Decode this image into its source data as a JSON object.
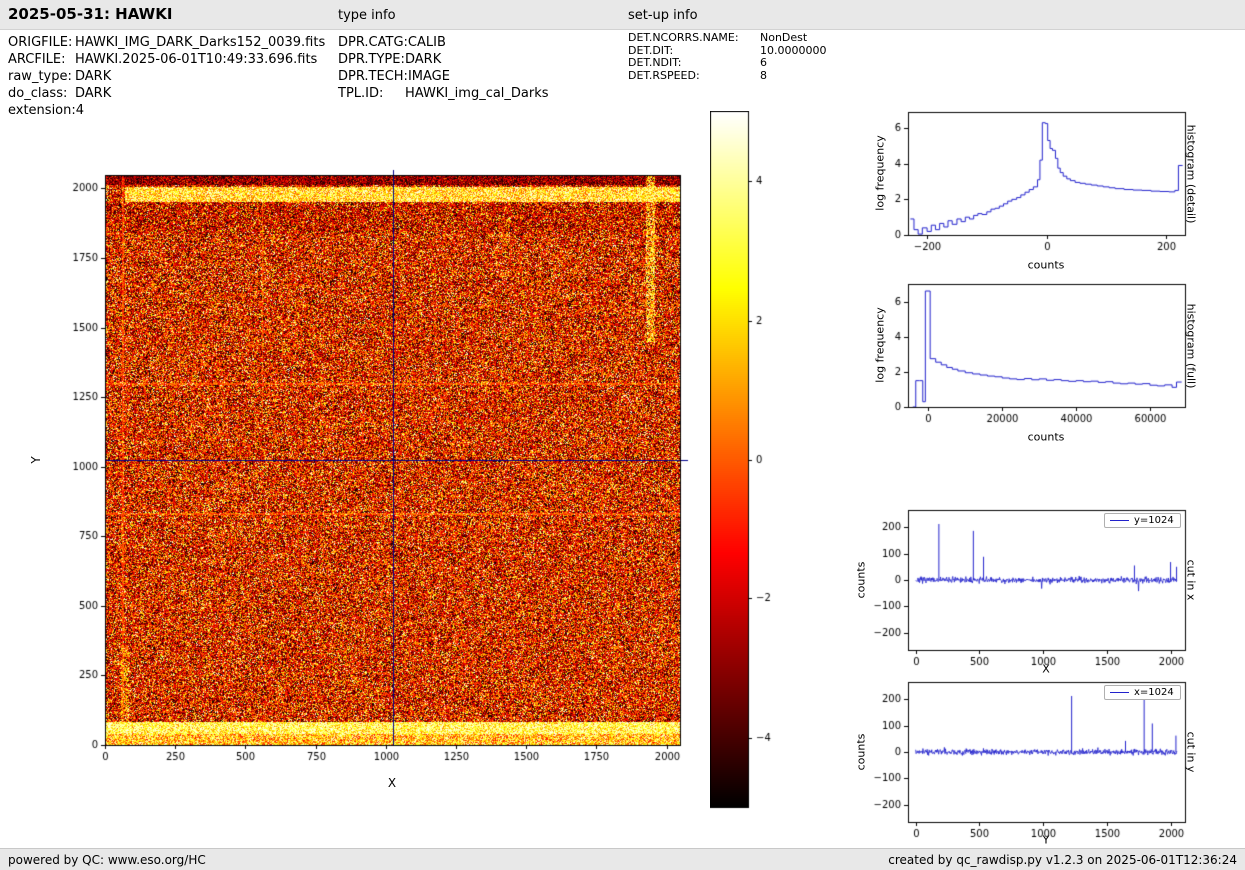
{
  "header": {
    "title": "2025-05-31: HAWKI",
    "type_info_label": "type info",
    "setup_info_label": "set-up info"
  },
  "file_info": {
    "rows": [
      {
        "label": "ORIGFILE:",
        "value": "HAWKI_IMG_DARK_Darks152_0039.fits"
      },
      {
        "label": "ARCFILE:",
        "value": "HAWKI.2025-06-01T10:49:33.696.fits"
      },
      {
        "label": "raw_type:",
        "value": "DARK"
      },
      {
        "label": "do_class:",
        "value": "DARK"
      },
      {
        "label": "extension:",
        "value": "4"
      }
    ]
  },
  "type_info": {
    "rows": [
      {
        "label": "DPR.CATG:",
        "value": "CALIB"
      },
      {
        "label": "DPR.TYPE:",
        "value": "DARK"
      },
      {
        "label": "DPR.TECH:",
        "value": "IMAGE"
      },
      {
        "label": "TPL.ID:",
        "value": "HAWKI_img_cal_Darks"
      }
    ]
  },
  "setup_info": {
    "rows": [
      {
        "label": "DET.NCORRS.NAME:",
        "value": "NonDest"
      },
      {
        "label": "DET.DIT:",
        "value": "10.0000000"
      },
      {
        "label": "DET.NDIT:",
        "value": "6"
      },
      {
        "label": "DET.RSPEED:",
        "value": "8"
      }
    ]
  },
  "footer": {
    "left": "powered by QC: www.eso.org/HC",
    "right": "created by qc_rawdisp.py v1.2.3 on 2025-06-01T12:36:24"
  },
  "colors": {
    "line": "#2222cc",
    "crosshair": "#00008b"
  },
  "chart_data": [
    {
      "id": "detector_image",
      "type": "heatmap",
      "xlabel": "X",
      "ylabel": "Y",
      "xlim": [
        0,
        2048
      ],
      "ylim": [
        0,
        2048
      ],
      "xticks": [
        0,
        250,
        500,
        750,
        1000,
        1250,
        1500,
        1750,
        2000
      ],
      "yticks": [
        0,
        250,
        500,
        750,
        1000,
        1250,
        1500,
        1750,
        2000
      ],
      "colormap": "hot",
      "crosshair": {
        "x": 1024,
        "y": 1024
      },
      "colorbar": {
        "range": [
          -5,
          5
        ],
        "ticks": [
          4,
          2,
          0,
          -2,
          -4
        ]
      },
      "description": "HAWKI dark frame, salt-and-pepper noise in hot colormap; bright arc along top edge, bright band along bottom rows, bright segments on left and right edges, faint horizontal lines",
      "features": {
        "bright_top_band_y": [
          1952,
          2006
        ],
        "bright_bottom_band_y": [
          0,
          85
        ],
        "bright_right_edge": {
          "x": [
            1925,
            1958
          ],
          "y": [
            1450,
            2048
          ]
        },
        "bright_left_edge": {
          "x": [
            55,
            82
          ],
          "y": [
            0,
            360
          ]
        },
        "faint_horizontal_lines_y": [
          832,
          1300
        ],
        "faint_vertical_lines_x": [
          62,
          560
        ]
      }
    },
    {
      "id": "histogram_detail",
      "type": "line",
      "style": "step",
      "right_label": "histogram (detail)",
      "xlabel": "counts",
      "ylabel": "log frequency",
      "xlim": [
        -232,
        232
      ],
      "ylim": [
        0,
        6.9
      ],
      "xticks": [
        -200,
        0,
        200
      ],
      "yticks": [
        0,
        2,
        4,
        6
      ],
      "points": [
        [
          -228,
          0.9
        ],
        [
          -222,
          0.3
        ],
        [
          -215,
          0.05
        ],
        [
          -208,
          0.4
        ],
        [
          -200,
          0.2
        ],
        [
          -193,
          0.55
        ],
        [
          -186,
          0.3
        ],
        [
          -179,
          0.65
        ],
        [
          -172,
          0.45
        ],
        [
          -165,
          0.8
        ],
        [
          -158,
          0.6
        ],
        [
          -150,
          0.9
        ],
        [
          -143,
          0.75
        ],
        [
          -136,
          1.0
        ],
        [
          -129,
          0.9
        ],
        [
          -122,
          1.1
        ],
        [
          -115,
          1.2
        ],
        [
          -108,
          1.15
        ],
        [
          -100,
          1.3
        ],
        [
          -93,
          1.45
        ],
        [
          -86,
          1.5
        ],
        [
          -79,
          1.62
        ],
        [
          -72,
          1.75
        ],
        [
          -65,
          1.9
        ],
        [
          -58,
          2.0
        ],
        [
          -50,
          2.1
        ],
        [
          -43,
          2.25
        ],
        [
          -36,
          2.4
        ],
        [
          -29,
          2.55
        ],
        [
          -22,
          2.7
        ],
        [
          -15,
          3.1
        ],
        [
          -11,
          4.2
        ],
        [
          -7,
          6.3
        ],
        [
          -2,
          6.25
        ],
        [
          2,
          5.3
        ],
        [
          6,
          4.85
        ],
        [
          10,
          4.75
        ],
        [
          15,
          4.3
        ],
        [
          19,
          3.75
        ],
        [
          23,
          3.5
        ],
        [
          28,
          3.3
        ],
        [
          34,
          3.15
        ],
        [
          40,
          3.05
        ],
        [
          48,
          2.95
        ],
        [
          56,
          2.9
        ],
        [
          65,
          2.85
        ],
        [
          75,
          2.8
        ],
        [
          85,
          2.75
        ],
        [
          95,
          2.7
        ],
        [
          105,
          2.65
        ],
        [
          115,
          2.6
        ],
        [
          130,
          2.55
        ],
        [
          145,
          2.52
        ],
        [
          160,
          2.5
        ],
        [
          175,
          2.46
        ],
        [
          190,
          2.44
        ],
        [
          205,
          2.42
        ],
        [
          215,
          2.5
        ],
        [
          221,
          3.9
        ],
        [
          228,
          3.9
        ]
      ]
    },
    {
      "id": "histogram_full",
      "type": "line",
      "style": "step",
      "right_label": "histogram (full)",
      "xlabel": "counts",
      "ylabel": "log frequency",
      "xlim": [
        -5500,
        69500
      ],
      "ylim": [
        0,
        7
      ],
      "xticks": [
        0,
        20000,
        40000,
        60000
      ],
      "yticks": [
        0,
        2,
        4,
        6
      ],
      "points": [
        [
          -4200,
          0
        ],
        [
          -3400,
          1.5
        ],
        [
          -2400,
          1.5
        ],
        [
          -1500,
          0.3
        ],
        [
          -800,
          6.6
        ],
        [
          500,
          2.75
        ],
        [
          2000,
          2.55
        ],
        [
          3500,
          2.4
        ],
        [
          5000,
          2.25
        ],
        [
          6500,
          2.15
        ],
        [
          8000,
          2.05
        ],
        [
          10000,
          1.95
        ],
        [
          12000,
          1.88
        ],
        [
          14000,
          1.82
        ],
        [
          16000,
          1.76
        ],
        [
          18000,
          1.72
        ],
        [
          20000,
          1.65
        ],
        [
          22000,
          1.6
        ],
        [
          24000,
          1.56
        ],
        [
          26000,
          1.62
        ],
        [
          28000,
          1.55
        ],
        [
          30000,
          1.6
        ],
        [
          32000,
          1.52
        ],
        [
          34000,
          1.56
        ],
        [
          36000,
          1.5
        ],
        [
          38000,
          1.46
        ],
        [
          40000,
          1.5
        ],
        [
          42000,
          1.44
        ],
        [
          44000,
          1.47
        ],
        [
          46000,
          1.4
        ],
        [
          48000,
          1.44
        ],
        [
          50000,
          1.36
        ],
        [
          52000,
          1.32
        ],
        [
          54000,
          1.36
        ],
        [
          56000,
          1.3
        ],
        [
          58000,
          1.33
        ],
        [
          60000,
          1.24
        ],
        [
          62000,
          1.2
        ],
        [
          64000,
          1.26
        ],
        [
          66000,
          1.12
        ],
        [
          67200,
          1.42
        ],
        [
          68600,
          1.42
        ]
      ]
    },
    {
      "id": "cut_in_x",
      "type": "line",
      "right_label": "cut in x",
      "legend": "y=1024",
      "xlabel": "X",
      "ylabel": "counts",
      "xlim": [
        -60,
        2110
      ],
      "ylim": [
        -265,
        265
      ],
      "xticks": [
        0,
        500,
        1000,
        1500,
        2000
      ],
      "yticks": [
        -200,
        -100,
        0,
        100,
        200
      ],
      "x_range": [
        0,
        2048
      ],
      "noise_amplitude": 12,
      "spikes": [
        [
          178,
          212
        ],
        [
          448,
          186
        ],
        [
          528,
          88
        ],
        [
          1710,
          55
        ],
        [
          1993,
          68
        ],
        [
          2040,
          50
        ]
      ]
    },
    {
      "id": "cut_in_y",
      "type": "line",
      "right_label": "cut in y",
      "legend": "x=1024",
      "xlabel": "Y",
      "ylabel": "counts",
      "xlim": [
        -60,
        2110
      ],
      "ylim": [
        -265,
        265
      ],
      "xticks": [
        0,
        500,
        1000,
        1500,
        2000
      ],
      "yticks": [
        -200,
        -100,
        0,
        100,
        200
      ],
      "x_range": [
        0,
        2048
      ],
      "noise_amplitude": 12,
      "spikes": [
        [
          1218,
          212
        ],
        [
          1640,
          42
        ],
        [
          1786,
          212
        ],
        [
          1850,
          108
        ],
        [
          2035,
          62
        ]
      ]
    }
  ]
}
